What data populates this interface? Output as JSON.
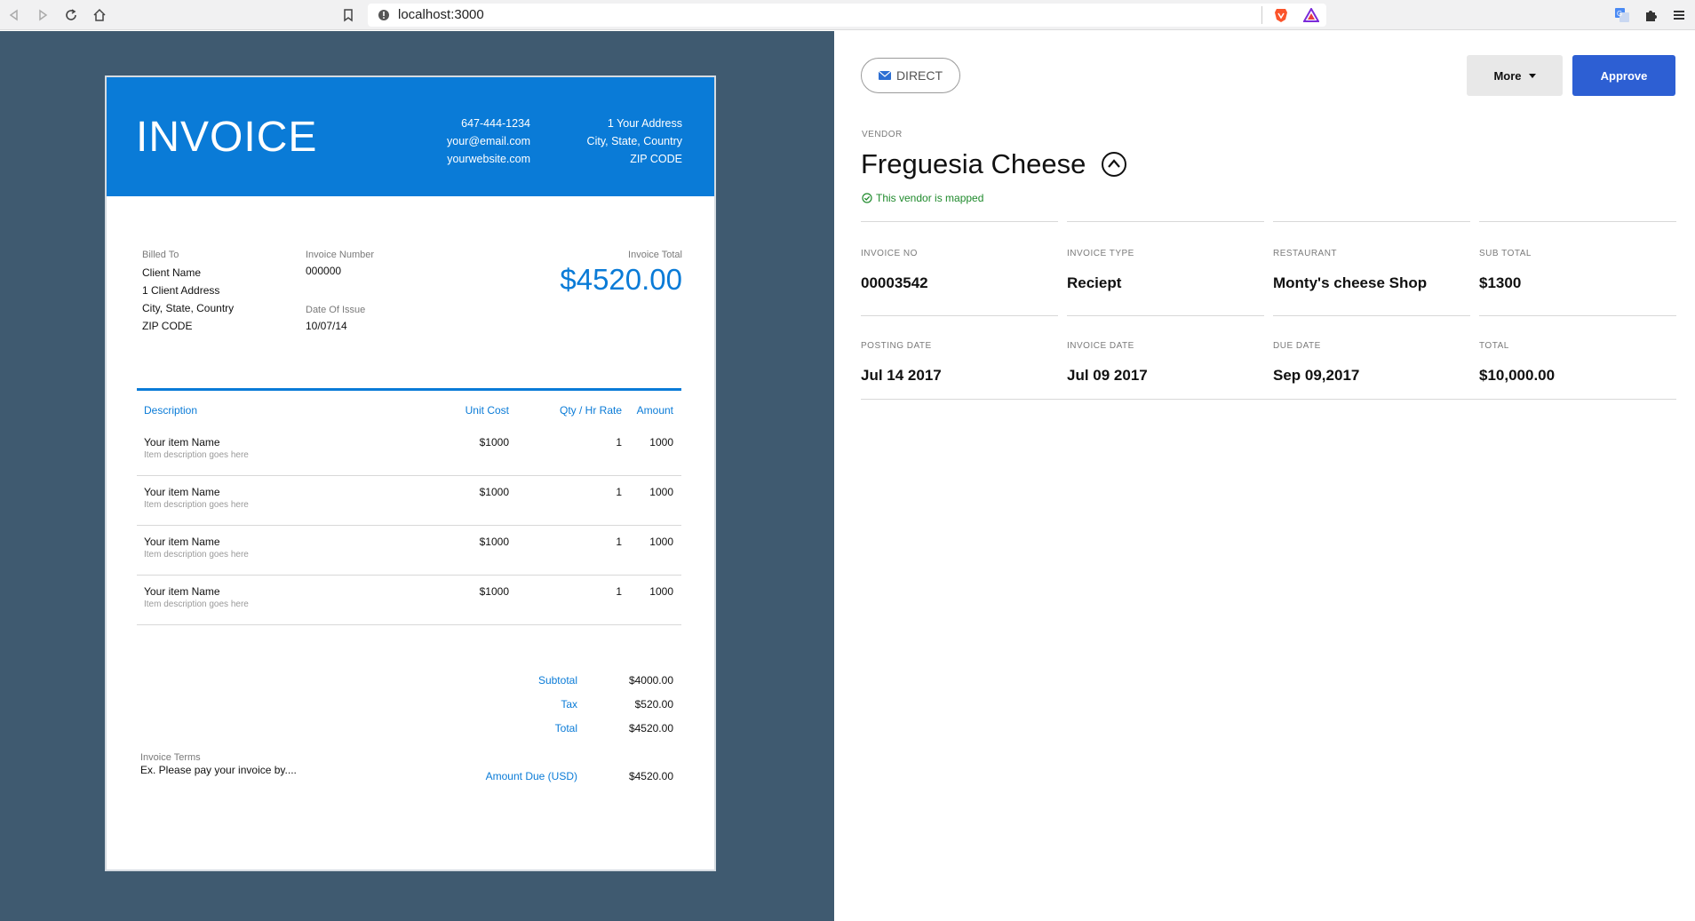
{
  "browser": {
    "url": "localhost:3000"
  },
  "invoice": {
    "title": "INVOICE",
    "phone": "647-444-1234",
    "email": "your@email.com",
    "website": "yourwebsite.com",
    "address_line1": "1 Your Address",
    "address_line2": "City, State, Country",
    "address_zip": "ZIP CODE",
    "billed_to_label": "Billed To",
    "client_name": "Client Name",
    "client_address": "1 Client Address",
    "client_city": "City, State, Country",
    "client_zip": "ZIP CODE",
    "invoice_number_label": "Invoice Number",
    "invoice_number": "000000",
    "date_label": "Date Of Issue",
    "date": "10/07/14",
    "total_label": "Invoice Total",
    "total": "$4520.00",
    "columns": [
      "Description",
      "Unit Cost",
      "Qty / Hr Rate",
      "Amount"
    ],
    "items": [
      {
        "name": "Your item Name",
        "desc": "Item description goes here",
        "unit": "$1000",
        "qty": "1",
        "amount": "1000"
      },
      {
        "name": "Your item Name",
        "desc": "Item description goes here",
        "unit": "$1000",
        "qty": "1",
        "amount": "1000"
      },
      {
        "name": "Your item Name",
        "desc": "Item description goes here",
        "unit": "$1000",
        "qty": "1",
        "amount": "1000"
      },
      {
        "name": "Your item Name",
        "desc": "Item description goes here",
        "unit": "$1000",
        "qty": "1",
        "amount": "1000"
      }
    ],
    "subtotal_label": "Subtotal",
    "subtotal": "$4000.00",
    "tax_label": "Tax",
    "tax": "$520.00",
    "total_row_label": "Total",
    "total_row": "$4520.00",
    "terms_label": "Invoice Terms",
    "terms": "Ex. Please pay your invoice by....",
    "amount_due_label": "Amount Due (USD)",
    "amount_due": "$4520.00"
  },
  "detail": {
    "pill_label": "DIRECT",
    "more_label": "More",
    "approve_label": "Approve",
    "vendor_label": "VENDOR",
    "vendor_name": "Freguesia Cheese",
    "mapped_text": "This vendor is mapped",
    "fields": [
      {
        "label": "INVOICE NO",
        "value": "00003542"
      },
      {
        "label": "INVOICE TYPE",
        "value": "Reciept"
      },
      {
        "label": "RESTAURANT",
        "value": "Monty's cheese Shop"
      },
      {
        "label": "SUB TOTAL",
        "value": "$1300"
      },
      {
        "label": "POSTING DATE",
        "value": "Jul 14 2017"
      },
      {
        "label": "INVOICE DATE",
        "value": "Jul 09 2017"
      },
      {
        "label": "DUE DATE",
        "value": "Sep 09,2017"
      },
      {
        "label": "TOTAL",
        "value": "$10,000.00"
      }
    ]
  },
  "colors": {
    "invoice_blue": "#0a7bd7",
    "panel_bg": "#3f5a70",
    "approve_blue": "#2d5fd3",
    "mapped_green": "#1f8a2c"
  }
}
